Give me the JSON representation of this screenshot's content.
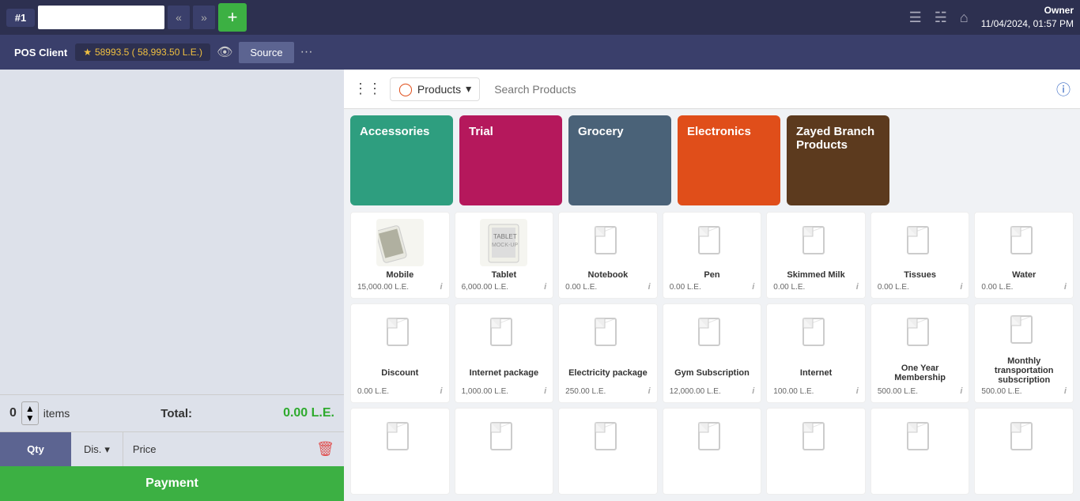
{
  "topbar": {
    "pos_number": "#1",
    "order_placeholder": "",
    "nav_prev": "«",
    "nav_next": "»",
    "add_label": "+",
    "owner_name": "Owner",
    "datetime": "11/04/2024, 01:57 PM",
    "icons": {
      "list": "≡",
      "register": "⊞",
      "home": "⌂"
    }
  },
  "secondbar": {
    "pos_client_label": "POS Client",
    "points": "58993.5 ( 58,993.50 L.E.)",
    "source_label": "Source",
    "more_label": "···"
  },
  "product_bar": {
    "products_label": "Products",
    "search_placeholder": "Search Products",
    "chevron": "▾"
  },
  "categories": [
    {
      "id": "accessories",
      "label": "Accessories",
      "color": "#2e9e7f"
    },
    {
      "id": "trial",
      "label": "Trial",
      "color": "#b5185c"
    },
    {
      "id": "grocery",
      "label": "Grocery",
      "color": "#4a6278"
    },
    {
      "id": "electronics",
      "label": "Electronics",
      "color": "#e04e1a"
    },
    {
      "id": "zayed",
      "label": "Zayed Branch Products",
      "color": "#5c3a1e"
    }
  ],
  "products": [
    {
      "id": "mobile",
      "name": "Mobile",
      "price": "15,000.00 L.E.",
      "has_image": true,
      "image_type": "phone"
    },
    {
      "id": "tablet",
      "name": "Tablet",
      "price": "6,000.00 L.E.",
      "has_image": true,
      "image_type": "tablet"
    },
    {
      "id": "notebook",
      "name": "Notebook",
      "price": "0.00 L.E.",
      "has_image": false
    },
    {
      "id": "pen",
      "name": "Pen",
      "price": "0.00 L.E.",
      "has_image": false
    },
    {
      "id": "skimmed-milk",
      "name": "Skimmed Milk",
      "price": "0.00 L.E.",
      "has_image": false
    },
    {
      "id": "tissues",
      "name": "Tissues",
      "price": "0.00 L.E.",
      "has_image": false
    },
    {
      "id": "water",
      "name": "Water",
      "price": "0.00 L.E.",
      "has_image": false
    },
    {
      "id": "discount",
      "name": "Discount",
      "price": "0.00 L.E.",
      "has_image": false
    },
    {
      "id": "internet-package",
      "name": "Internet package",
      "price": "1,000.00 L.E.",
      "has_image": false
    },
    {
      "id": "electricity-package",
      "name": "Electricity package",
      "price": "250.00 L.E.",
      "has_image": false
    },
    {
      "id": "gym-subscription",
      "name": "Gym Subscription",
      "price": "12,000.00 L.E.",
      "has_image": false
    },
    {
      "id": "internet",
      "name": "Internet",
      "price": "100.00 L.E.",
      "has_image": false
    },
    {
      "id": "one-year",
      "name": "One Year Membership",
      "price": "500.00 L.E.",
      "has_image": false
    },
    {
      "id": "monthly-transport",
      "name": "Monthly transportation subscription",
      "price": "500.00 L.E.",
      "has_image": false
    },
    {
      "id": "p15",
      "name": "",
      "price": "",
      "has_image": false
    },
    {
      "id": "p16",
      "name": "",
      "price": "",
      "has_image": false
    },
    {
      "id": "p17",
      "name": "",
      "price": "",
      "has_image": false
    },
    {
      "id": "p18",
      "name": "",
      "price": "",
      "has_image": false
    },
    {
      "id": "p19",
      "name": "",
      "price": "",
      "has_image": false
    },
    {
      "id": "p20",
      "name": "",
      "price": "",
      "has_image": false
    },
    {
      "id": "p21",
      "name": "",
      "price": "",
      "has_image": false
    }
  ],
  "leftpanel": {
    "items_count": "0",
    "items_label": "items",
    "total_label": "Total:",
    "total_value": "0.00 L.E.",
    "qty_label": "Qty",
    "dis_label": "Dis.",
    "price_label": "Price",
    "payment_label": "Payment"
  }
}
